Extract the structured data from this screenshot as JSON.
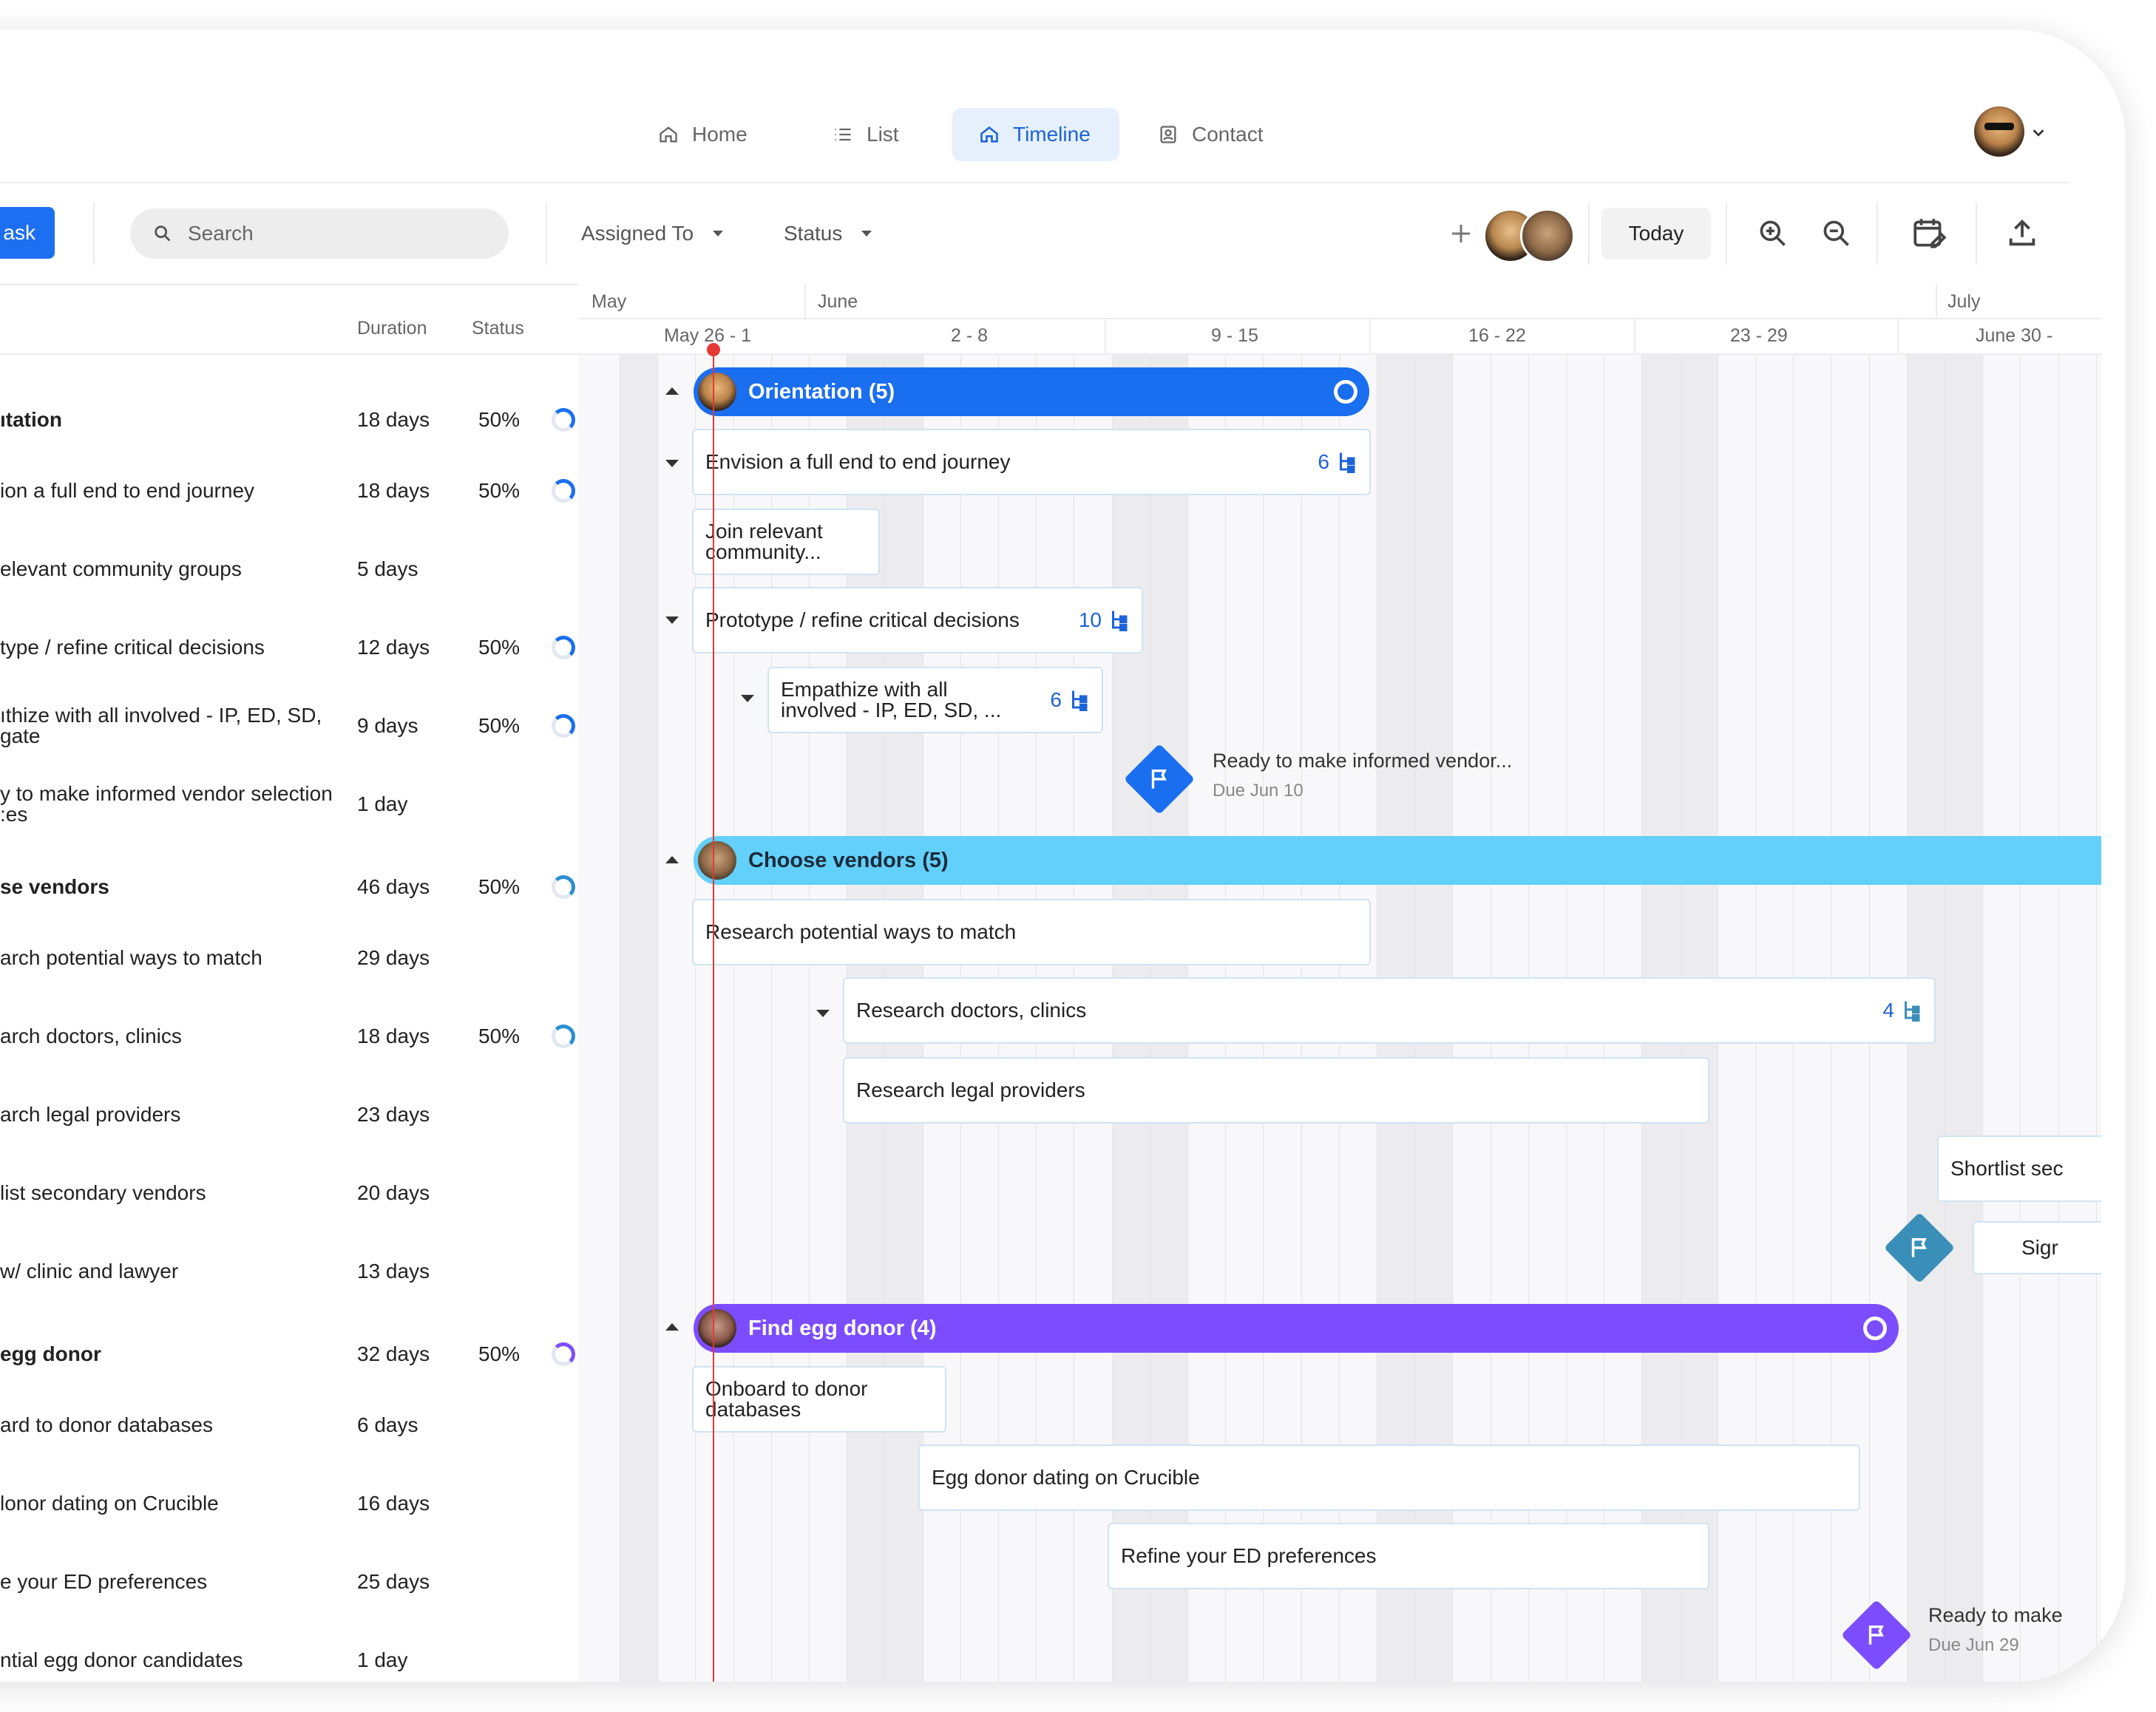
{
  "nav": {
    "tabs": [
      {
        "label": "Home",
        "icon": "home-icon"
      },
      {
        "label": "List",
        "icon": "list-icon"
      },
      {
        "label": "Timeline",
        "icon": "home-icon",
        "active": true
      },
      {
        "label": "Contact",
        "icon": "contact-icon"
      }
    ]
  },
  "toolbar": {
    "add_task_label": "ask",
    "search_placeholder": "Search",
    "assigned_to_label": "Assigned To",
    "status_label": "Status",
    "today_label": "Today"
  },
  "columns": {
    "duration": "Duration",
    "status": "Status"
  },
  "rows": [
    {
      "name": "ıtation",
      "duration": "18 days",
      "status": "50%",
      "bold": true,
      "ring_color": "#1a6ef0"
    },
    {
      "name": "ion a full end to end journey",
      "duration": "18 days",
      "status": "50%",
      "ring_color": "#1a6ef0"
    },
    {
      "name": "elevant community groups",
      "duration": "5 days"
    },
    {
      "name": "type / refine critical decisions",
      "duration": "12 days",
      "status": "50%",
      "ring_color": "#1a6ef0"
    },
    {
      "name": "ıthize with all involved - IP, ED, SD,",
      "name2": "gate",
      "duration": "9 days",
      "status": "50%",
      "ring_color": "#1a6ef0"
    },
    {
      "name": "y to make informed vendor selection",
      "name2": ":es",
      "duration": "1 day"
    },
    {
      "name": "se vendors",
      "duration": "46 days",
      "status": "50%",
      "bold": true,
      "ring_color": "#2a8fd1"
    },
    {
      "name": "arch potential ways to match",
      "duration": "29 days"
    },
    {
      "name": "arch doctors, clinics",
      "duration": "18 days",
      "status": "50%",
      "ring_color": "#2a8fd1"
    },
    {
      "name": "arch legal providers",
      "duration": "23 days"
    },
    {
      "name": "list secondary vendors",
      "duration": "20 days"
    },
    {
      "name": "w/ clinic and lawyer",
      "duration": "13 days"
    },
    {
      "name": "egg donor",
      "duration": "32 days",
      "status": "50%",
      "bold": true,
      "ring_color": "#7c4dff"
    },
    {
      "name": "ard to donor databases",
      "duration": "6 days"
    },
    {
      "name": "lonor dating on Crucible",
      "duration": "16 days"
    },
    {
      "name": "e your ED preferences",
      "duration": "25 days"
    },
    {
      "name": "ntial egg donor candidates",
      "duration": "1 day"
    }
  ],
  "timeline": {
    "months": [
      "May",
      "June",
      "July"
    ],
    "weeks": [
      "May 26 - 1",
      "2 - 8",
      "9 - 15",
      "16 - 22",
      "23 - 29",
      "June 30 -"
    ],
    "groups": [
      {
        "label": "Orientation (5)",
        "color": "#1a6ef0"
      },
      {
        "label": "Choose vendors (5)",
        "color": "#62d0fa"
      },
      {
        "label": "Find egg donor (4)",
        "color": "#7c4dff"
      }
    ],
    "tasks": {
      "envision": {
        "label": "Envision a full end to end journey",
        "count": "6"
      },
      "join": {
        "label": "Join relevant community..."
      },
      "prototype": {
        "label": "Prototype / refine critical decisions",
        "count": "10"
      },
      "empathize": {
        "label": "Empathize with all involved - IP, ED, SD, ...",
        "count": "6"
      },
      "research_ways": {
        "label": "Research potential ways to match"
      },
      "research_doctors": {
        "label": "Research doctors, clinics",
        "count": "4"
      },
      "research_legal": {
        "label": "Research legal providers"
      },
      "shortlist": {
        "label": "Shortlist sec"
      },
      "sign": {
        "label": "Sigr"
      },
      "onboard": {
        "label": "Onboard to donor databases"
      },
      "dating": {
        "label": "Egg donor dating on Crucible"
      },
      "refine": {
        "label": "Refine your ED preferences"
      }
    },
    "milestones": [
      {
        "label": "Ready to make informed vendor...",
        "due": "Due Jun 10",
        "color": "#1a6ef0"
      },
      {
        "label": "",
        "due": "",
        "color": "#3a8fb8"
      },
      {
        "label": "Ready to make",
        "due": "Due Jun 29",
        "color": "#7c4dff"
      }
    ]
  }
}
